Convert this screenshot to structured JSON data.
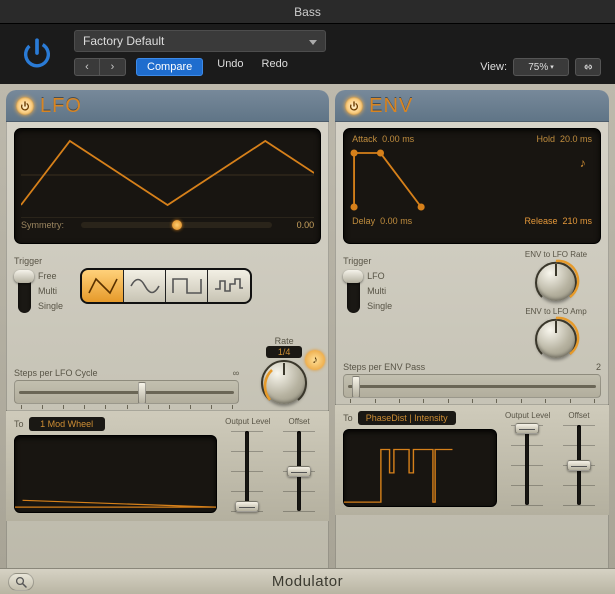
{
  "colors": {
    "accent_orange": "#d6801a",
    "panel_bg": "#bdb9ac",
    "display_bg": "#181511"
  },
  "window": {
    "title": "Bass"
  },
  "header": {
    "preset": "Factory Default",
    "compare": "Compare",
    "undo": "Undo",
    "redo": "Redo",
    "view_label": "View:",
    "zoom": "75%"
  },
  "lfo": {
    "title": "LFO",
    "symmetry": {
      "label": "Symmetry:",
      "value": "0.00",
      "value_normalized": 0.5
    },
    "trigger": {
      "label": "Trigger",
      "options": [
        "Free",
        "Multi",
        "Single"
      ],
      "selected_index": 0
    },
    "wave_shapes": [
      "triangle",
      "sine",
      "square",
      "random"
    ],
    "wave_selected_index": 0,
    "steps": {
      "label": "Steps per LFO Cycle",
      "value": "∞",
      "slider_normalized": 0.55
    },
    "rate": {
      "label": "Rate",
      "display": "1/4",
      "knob_normalized": 0.35,
      "sync_on": true
    },
    "output": {
      "to_label": "To",
      "destination": "1 Mod Wheel",
      "level": {
        "label": "Output Level",
        "normalized": 0.12
      },
      "offset": {
        "label": "Offset",
        "normalized": 0.5
      }
    }
  },
  "env": {
    "title": "ENV",
    "params": {
      "attack": {
        "label": "Attack",
        "value": "0.00 ms"
      },
      "hold": {
        "label": "Hold",
        "value": "20.0 ms"
      },
      "delay": {
        "label": "Delay",
        "value": "0.00 ms"
      },
      "release": {
        "label": "Release",
        "value": "210 ms"
      }
    },
    "trigger": {
      "label": "Trigger",
      "options": [
        "LFO",
        "Multi",
        "Single"
      ],
      "selected_index": 0
    },
    "env_to_lfo_rate": {
      "label": "ENV to LFO Rate",
      "normalized": 0.5
    },
    "env_to_lfo_amp": {
      "label": "ENV to LFO Amp",
      "normalized": 0.5
    },
    "steps": {
      "label": "Steps per ENV Pass",
      "value": "2",
      "slider_normalized": 0.05
    },
    "output": {
      "to_label": "To",
      "destination": "PhaseDist | Intensity",
      "level": {
        "label": "Output Level",
        "normalized": 0.95
      },
      "offset": {
        "label": "Offset",
        "normalized": 0.5
      }
    }
  },
  "footer": {
    "plugin_name": "Modulator"
  }
}
